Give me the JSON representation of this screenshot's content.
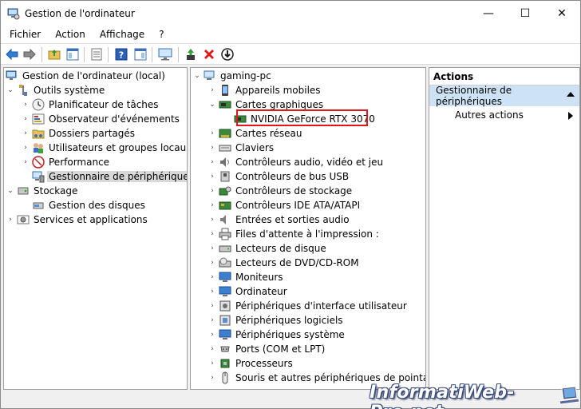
{
  "window": {
    "title": "Gestion de l'ordinateur",
    "minimize_glyph": "—",
    "maximize_glyph": "☐",
    "close_glyph": "✕"
  },
  "menu": [
    {
      "label": "Fichier"
    },
    {
      "label": "Action"
    },
    {
      "label": "Affichage"
    },
    {
      "label": "?"
    }
  ],
  "left_tree": {
    "root": "Gestion de l'ordinateur (local)",
    "items": [
      {
        "label": "Outils système",
        "icon": "tools-icon"
      },
      {
        "label": "Planificateur de tâches",
        "icon": "clock-icon"
      },
      {
        "label": "Observateur d'événements",
        "icon": "event-viewer-icon"
      },
      {
        "label": "Dossiers partagés",
        "icon": "shared-folder-icon"
      },
      {
        "label": "Utilisateurs et groupes locaux",
        "icon": "users-icon"
      },
      {
        "label": "Performance",
        "icon": "performance-icon"
      },
      {
        "label": "Gestionnaire de périphériques",
        "icon": "device-manager-icon"
      },
      {
        "label": "Stockage",
        "icon": "storage-icon"
      },
      {
        "label": "Gestion des disques",
        "icon": "disk-management-icon"
      },
      {
        "label": "Services et applications",
        "icon": "services-icon"
      }
    ]
  },
  "device_tree": {
    "root": "gaming-pc",
    "items": [
      {
        "label": "Appareils mobiles"
      },
      {
        "label": "Cartes graphiques"
      },
      {
        "label": "NVIDIA GeForce RTX 3070"
      },
      {
        "label": "Cartes réseau"
      },
      {
        "label": "Claviers"
      },
      {
        "label": "Contrôleurs audio, vidéo et jeu"
      },
      {
        "label": "Contrôleurs de bus USB"
      },
      {
        "label": "Contrôleurs de stockage"
      },
      {
        "label": "Contrôleurs IDE ATA/ATAPI"
      },
      {
        "label": "Entrées et sorties audio"
      },
      {
        "label": "Files d'attente à l'impression :"
      },
      {
        "label": "Lecteurs de disque"
      },
      {
        "label": "Lecteurs de DVD/CD-ROM"
      },
      {
        "label": "Moniteurs"
      },
      {
        "label": "Ordinateur"
      },
      {
        "label": "Périphériques d'interface utilisateur"
      },
      {
        "label": "Périphériques logiciels"
      },
      {
        "label": "Périphériques système"
      },
      {
        "label": "Ports (COM et LPT)"
      },
      {
        "label": "Processeurs"
      },
      {
        "label": "Souris et autres périphériques de pointage"
      }
    ]
  },
  "actions": {
    "header": "Actions",
    "section": "Gestionnaire de périphériques",
    "more": "Autres actions"
  },
  "watermark": "InformatiWeb-Pro.net",
  "colors": {
    "highlight_border": "#e0161b",
    "action_section_bg": "#cde3f5",
    "selected_grey": "#d9d9d9"
  }
}
